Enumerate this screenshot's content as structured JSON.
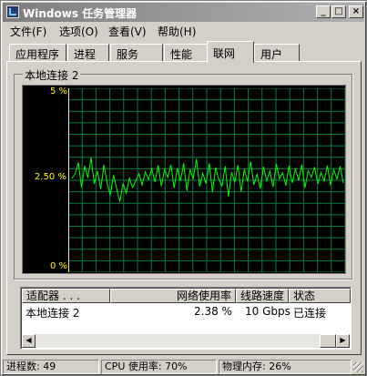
{
  "window": {
    "title": "Windows 任务管理器"
  },
  "menu": [
    "文件(F)",
    "选项(O)",
    "查看(V)",
    "帮助(H)"
  ],
  "tabs": [
    "应用程序",
    "进程",
    "服务",
    "性能",
    "联网",
    "用户"
  ],
  "active_tab": "联网",
  "group": {
    "label": "本地连接 2",
    "y_ticks": [
      "5 %",
      "2.50 %",
      "0 %"
    ],
    "chart_data": {
      "type": "line",
      "ylabel": "",
      "ylim": [
        0,
        5
      ],
      "ticks": [
        "5 %",
        "2.50 %",
        "0 %"
      ],
      "grid": true,
      "series": [
        {
          "color": "#00ff00",
          "values": [
            2.55,
            2.68,
            2.98,
            2.31,
            2.89,
            2.57,
            3.12,
            2.4,
            2.75,
            2.26,
            2.92,
            2.43,
            2.1,
            2.64,
            2.28,
            1.92,
            2.41,
            2.15,
            2.56,
            2.3,
            2.49,
            2.68,
            2.37,
            2.73,
            2.52,
            2.81,
            2.45,
            2.91,
            2.34,
            2.79,
            2.58,
            2.92,
            2.29,
            2.83,
            2.48,
            2.96,
            2.21,
            2.78,
            2.55,
            3.08,
            2.33,
            2.69,
            2.41,
            2.96,
            2.18,
            2.84,
            2.52,
            2.35,
            2.88,
            2.06,
            2.72,
            2.44,
            2.91,
            2.19,
            2.8,
            2.47,
            3.01,
            2.38,
            2.66,
            2.27,
            2.87,
            2.49,
            2.75,
            2.32,
            2.95,
            2.54,
            2.7,
            2.36,
            2.89,
            2.43,
            2.81,
            2.5,
            2.92,
            2.3,
            2.76,
            2.58,
            2.86,
            2.4,
            2.71,
            2.48,
            2.9,
            2.37,
            2.79,
            2.53,
            2.88,
            2.42
          ]
        }
      ]
    }
  },
  "list": {
    "columns": [
      "适配器 . . .",
      "网络使用率",
      "线路速度",
      "状态"
    ],
    "rows": [
      {
        "adapter": "本地连接 2",
        "usage": "2.38 %",
        "speed": "10 Gbps",
        "state": "已连接"
      }
    ]
  },
  "status": {
    "processes": "进程数: 49",
    "cpu": "CPU 使用率: 70%",
    "memory": "物理内存: 26%"
  }
}
